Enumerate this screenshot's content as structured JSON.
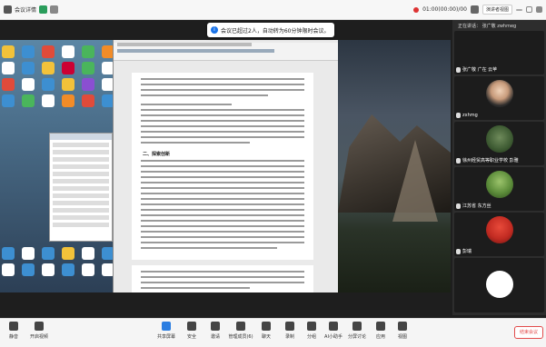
{
  "topbar": {
    "meeting_label": "会议详情",
    "time": "01:00(00:00)/00",
    "record_label": "演讲者视图"
  },
  "toast": {
    "text": "会议已超过2人，自动转为60分钟限时会议。"
  },
  "participants_panel": {
    "header": "正在讲话：",
    "speaker": "张广敬  zwhmeg",
    "tiles": [
      {
        "name": "张广敬 广在 云苹"
      },
      {
        "name": "zxhmg"
      },
      {
        "name": "徐州经贸高等职业学校 彭雅"
      },
      {
        "name": "江苏省 东方丝"
      },
      {
        "name": "彭瑞"
      },
      {
        "name": ""
      }
    ]
  },
  "toolbar": {
    "items": [
      {
        "label": "静音"
      },
      {
        "label": "开启视频"
      },
      {
        "label": "共享屏幕"
      },
      {
        "label": "安全"
      },
      {
        "label": "邀请"
      },
      {
        "label": "管理成员(6)"
      },
      {
        "label": "聊天"
      },
      {
        "label": "录制"
      },
      {
        "label": "分组"
      },
      {
        "label": "AI小助手"
      },
      {
        "label": "分屏讨论"
      },
      {
        "label": "应用"
      },
      {
        "label": "视图"
      }
    ],
    "leave_label": "结束会议"
  },
  "document": {
    "section_heading": "二、探索创新"
  }
}
